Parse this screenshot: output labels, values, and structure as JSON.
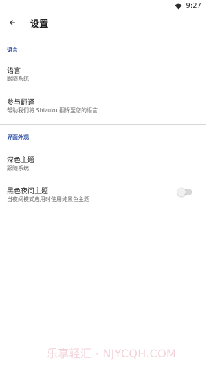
{
  "status_bar": {
    "time": "9:27",
    "wifi_icon": "wifi-icon"
  },
  "toolbar": {
    "back_icon": "arrow-left-icon",
    "title": "设置"
  },
  "sections": [
    {
      "header": "语言",
      "items": [
        {
          "title": "语言",
          "subtitle": "跟随系统"
        },
        {
          "title": "参与翻译",
          "subtitle": "帮助我们将 Shizuku 翻译至您的语言"
        }
      ]
    },
    {
      "header": "界面外观",
      "items": [
        {
          "title": "深色主题",
          "subtitle": "跟随系统"
        },
        {
          "title": "黑色夜间主题",
          "subtitle": "当夜间模式启用时使用纯黑色主题",
          "toggle": {
            "checked": false
          }
        }
      ]
    }
  ],
  "watermark": "乐享轻汇 · NJYCQH.COM",
  "colors": {
    "accent": "#3453a6",
    "watermark": "#f3d2d9"
  }
}
